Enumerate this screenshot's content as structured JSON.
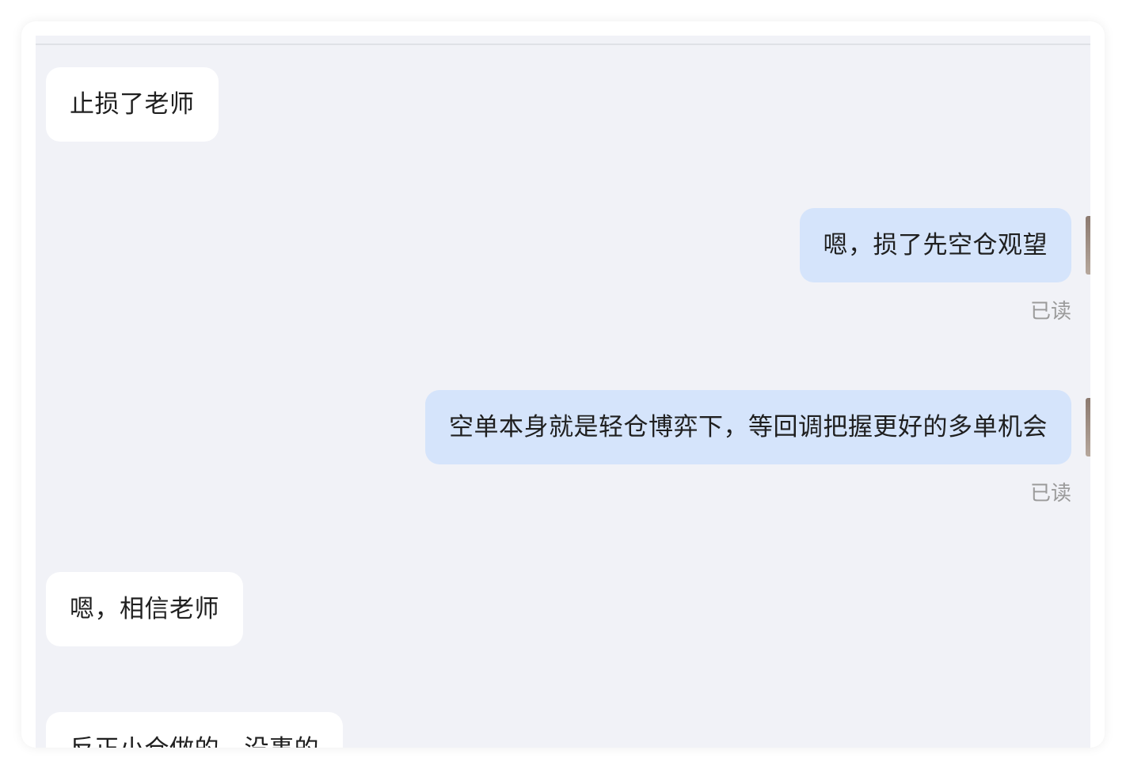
{
  "messages": [
    {
      "side": "incoming",
      "text": "止损了老师"
    },
    {
      "side": "outgoing",
      "text": "嗯，损了先空仓观望",
      "status": "已读"
    },
    {
      "side": "outgoing",
      "text": "空单本身就是轻仓博弈下，等回调把握更好的多单机会",
      "status": "已读"
    },
    {
      "side": "incoming",
      "text": "嗯，相信老师"
    },
    {
      "side": "incoming",
      "text": "反正小仓做的，没事的"
    }
  ]
}
